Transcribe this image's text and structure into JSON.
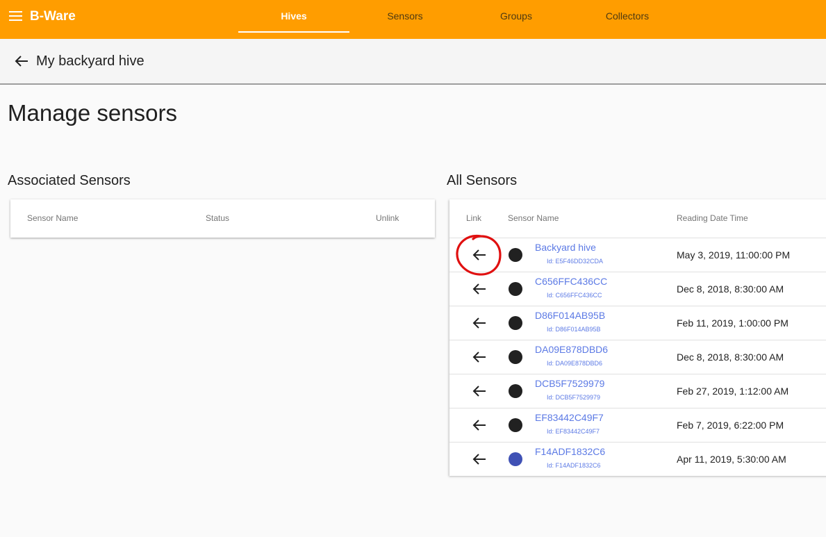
{
  "app": {
    "brand": "B-Ware",
    "nav_tabs": [
      {
        "label": "Hives",
        "active": true
      },
      {
        "label": "Sensors",
        "active": false
      },
      {
        "label": "Groups",
        "active": false
      },
      {
        "label": "Collectors",
        "active": false
      }
    ],
    "accent_color": "#ff9d00"
  },
  "subheader": {
    "title": "My backyard hive"
  },
  "page": {
    "title": "Manage sensors"
  },
  "associated": {
    "title": "Associated Sensors",
    "columns": [
      "Sensor Name",
      "Status",
      "Unlink"
    ]
  },
  "all_sensors": {
    "title": "All Sensors",
    "columns": [
      "Link",
      "Sensor Name",
      "Reading Date Time"
    ],
    "rows": [
      {
        "name": "Backyard hive",
        "id": "Id: E5F46DD32CDA",
        "reading": "May 3, 2019, 11:00:00 PM",
        "status_color": "#212121",
        "icon": "arrow-left-icon"
      },
      {
        "name": "C656FFC436CC",
        "id": "Id: C656FFC436CC",
        "reading": "Dec 8, 2018, 8:30:00 AM",
        "status_color": "#212121",
        "icon": "arrow-left-icon"
      },
      {
        "name": "D86F014AB95B",
        "id": "Id: D86F014AB95B",
        "reading": "Feb 11, 2019, 1:00:00 PM",
        "status_color": "#212121",
        "icon": "arrow-left-icon"
      },
      {
        "name": "DA09E878DBD6",
        "id": "Id: DA09E878DBD6",
        "reading": "Dec 8, 2018, 8:30:00 AM",
        "status_color": "#212121",
        "icon": "arrow-left-icon"
      },
      {
        "name": "DCB5F7529979",
        "id": "Id: DCB5F7529979",
        "reading": "Feb 27, 2019, 1:12:00 AM",
        "status_color": "#212121",
        "icon": "arrow-left-icon"
      },
      {
        "name": "EF83442C49F7",
        "id": "Id: EF83442C49F7",
        "reading": "Feb 7, 2019, 6:22:00 PM",
        "status_color": "#212121",
        "icon": "arrow-left-icon"
      },
      {
        "name": "F14ADF1832C6",
        "id": "Id: F14ADF1832C6",
        "reading": "Apr 11, 2019, 5:30:00 AM",
        "status_color": "#3f51b5",
        "icon": "arrow-left-icon"
      }
    ]
  },
  "annotation": {
    "color": "#e01010"
  }
}
